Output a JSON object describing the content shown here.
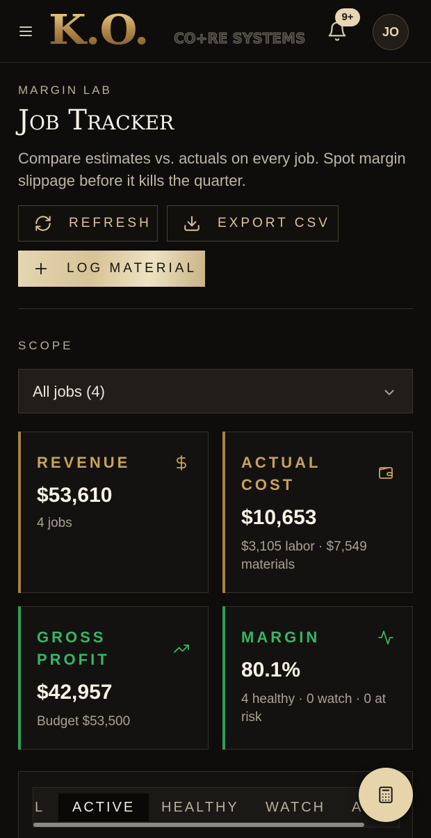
{
  "header": {
    "logo_main": "K.O.",
    "logo_sub": "CO+RE SYSTEMS",
    "notification_badge": "9+",
    "avatar_initials": "JO"
  },
  "page": {
    "eyebrow": "MARGIN LAB",
    "title": "Job Tracker",
    "subtitle": "Compare estimates vs. actuals on every job. Spot margin slippage before it kills the quarter."
  },
  "actions": {
    "refresh_label": "REFRESH",
    "export_label": "EXPORT CSV",
    "log_material_label": "LOG MATERIAL"
  },
  "scope": {
    "label": "SCOPE",
    "selected": "All jobs (4)"
  },
  "kpis": {
    "revenue": {
      "label": "REVENUE",
      "value": "$53,610",
      "note": "4 jobs",
      "icon": "dollar-icon"
    },
    "actual_cost": {
      "label": "ACTUAL COST",
      "value": "$10,653",
      "note": "$3,105 labor · $7,549 materials",
      "icon": "wallet-icon"
    },
    "gross_profit": {
      "label": "GROSS PROFIT",
      "value": "$42,957",
      "note": "Budget $53,500",
      "icon": "trending-up-icon"
    },
    "margin": {
      "label": "MARGIN",
      "value": "80.1%",
      "note": "4 healthy · 0 watch · 0 at risk",
      "icon": "activity-icon"
    }
  },
  "tabs": [
    "L",
    "ACTIVE",
    "HEALTHY",
    "WATCH",
    "A"
  ],
  "colors": {
    "gold": "#c9a35a",
    "green": "#33b865",
    "background": "#0e0d0b",
    "button_light": "#e6d4ab"
  }
}
